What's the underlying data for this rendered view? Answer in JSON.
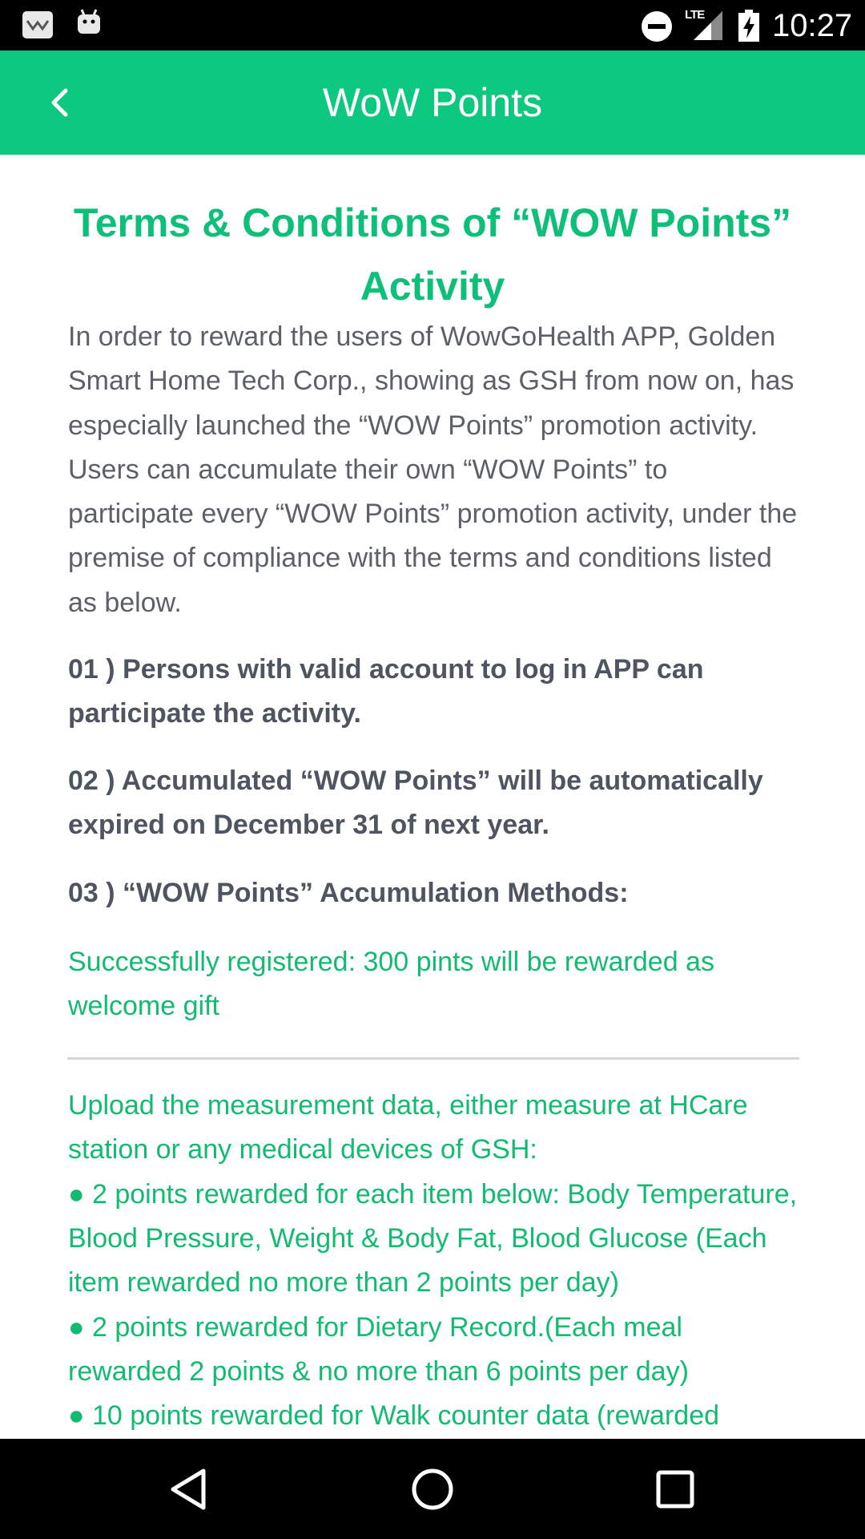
{
  "status_bar": {
    "time": "10:27",
    "network": "LTE"
  },
  "app_bar": {
    "title": "WoW Points"
  },
  "content": {
    "title": "Terms & Conditions of “WOW Points” Activity",
    "intro": "In order to reward the users of WowGoHealth APP, Golden Smart Home Tech Corp., showing as GSH from now on, has especially launched the “WOW Points” promotion activity. Users can accumulate their own “WOW Points” to participate every “WOW Points” promotion activity, under the premise of compliance with the terms and conditions listed as below.",
    "rules": [
      "01 ) Persons with valid account to log in APP can participate the activity.",
      "02 ) Accumulated “WOW Points” will be automatically expired on December 31 of next year.",
      "03 ) “WOW Points” Accumulation Methods:"
    ],
    "welcome": "Successfully registered: 300 pints will be rewarded as welcome gift",
    "upload_intro": "Upload the measurement data, either measure at HCare station or any medical devices of GSH:",
    "upload_items": [
      "● 2 points rewarded for each item below: Body Temperature, Blood Pressure, Weight & Body Fat, Blood Glucose (Each item rewarded no more than 2 points per day)",
      "● 2 points rewarded for Dietary Record.(Each meal rewarded 2 points & no more than 6 points per day)",
      "● 10 points rewarded for Walk counter data (rewarded"
    ]
  },
  "icons": {
    "back": "chevron-left-icon",
    "nav_back": "triangle-back-icon",
    "nav_home": "circle-home-icon",
    "nav_recents": "square-recents-icon"
  },
  "colors": {
    "accent": "#0dc87f",
    "title_green": "#0dbf78",
    "body_text": "#5c6168",
    "bold_text": "#4f5560",
    "green_text": "#12ba72"
  }
}
